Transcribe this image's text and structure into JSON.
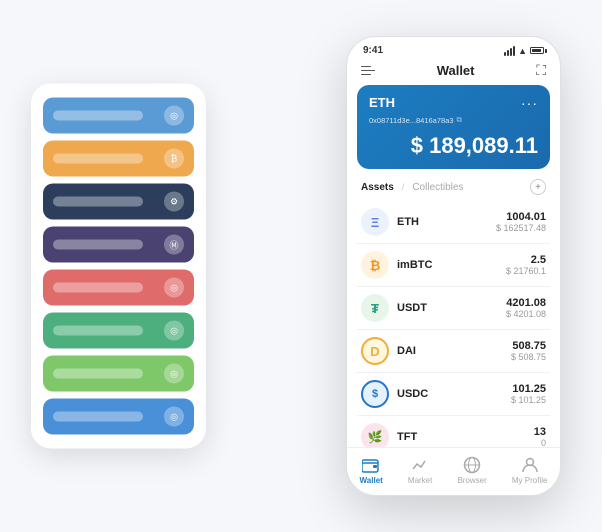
{
  "scene": {
    "background": "#f5f7fa"
  },
  "cardStack": {
    "cards": [
      {
        "color": "c1",
        "label": ""
      },
      {
        "color": "c2",
        "label": ""
      },
      {
        "color": "c3",
        "label": ""
      },
      {
        "color": "c4",
        "label": ""
      },
      {
        "color": "c5",
        "label": ""
      },
      {
        "color": "c6",
        "label": ""
      },
      {
        "color": "c7",
        "label": ""
      },
      {
        "color": "c8",
        "label": ""
      }
    ]
  },
  "phone": {
    "statusBar": {
      "time": "9:41"
    },
    "header": {
      "title": "Wallet"
    },
    "ethCard": {
      "ticker": "ETH",
      "address": "0x08711d3e...8416a78a3",
      "balance": "$ 189,089.11",
      "currency": "$"
    },
    "assetsSection": {
      "activeTab": "Assets",
      "inactiveTab": "Collectibles"
    },
    "assets": [
      {
        "symbol": "ETH",
        "icon": "Ξ",
        "iconBg": "#ecf2fb",
        "iconColor": "#627eea",
        "amount": "1004.01",
        "usd": "$ 162517.48"
      },
      {
        "symbol": "imBTC",
        "icon": "₿",
        "iconBg": "#fff3e0",
        "iconColor": "#f7931a",
        "amount": "2.5",
        "usd": "$ 21760.1"
      },
      {
        "symbol": "USDT",
        "icon": "₮",
        "iconBg": "#e8f5e9",
        "iconColor": "#26a17b",
        "amount": "4201.08",
        "usd": "$ 4201.08"
      },
      {
        "symbol": "DAI",
        "icon": "◈",
        "iconBg": "#fff8e1",
        "iconColor": "#f5ac37",
        "amount": "508.75",
        "usd": "$ 508.75"
      },
      {
        "symbol": "USDC",
        "icon": "$",
        "iconBg": "#e3f2fd",
        "iconColor": "#2775ca",
        "amount": "101.25",
        "usd": "$ 101.25"
      },
      {
        "symbol": "TFT",
        "icon": "🌿",
        "iconBg": "#f3e5f5",
        "iconColor": "#9c27b0",
        "amount": "13",
        "usd": "0"
      }
    ],
    "bottomNav": [
      {
        "label": "Wallet",
        "active": true,
        "icon": "👛"
      },
      {
        "label": "Market",
        "active": false,
        "icon": "📊"
      },
      {
        "label": "Browser",
        "active": false,
        "icon": "🌐"
      },
      {
        "label": "My Profile",
        "active": false,
        "icon": "👤"
      }
    ]
  }
}
